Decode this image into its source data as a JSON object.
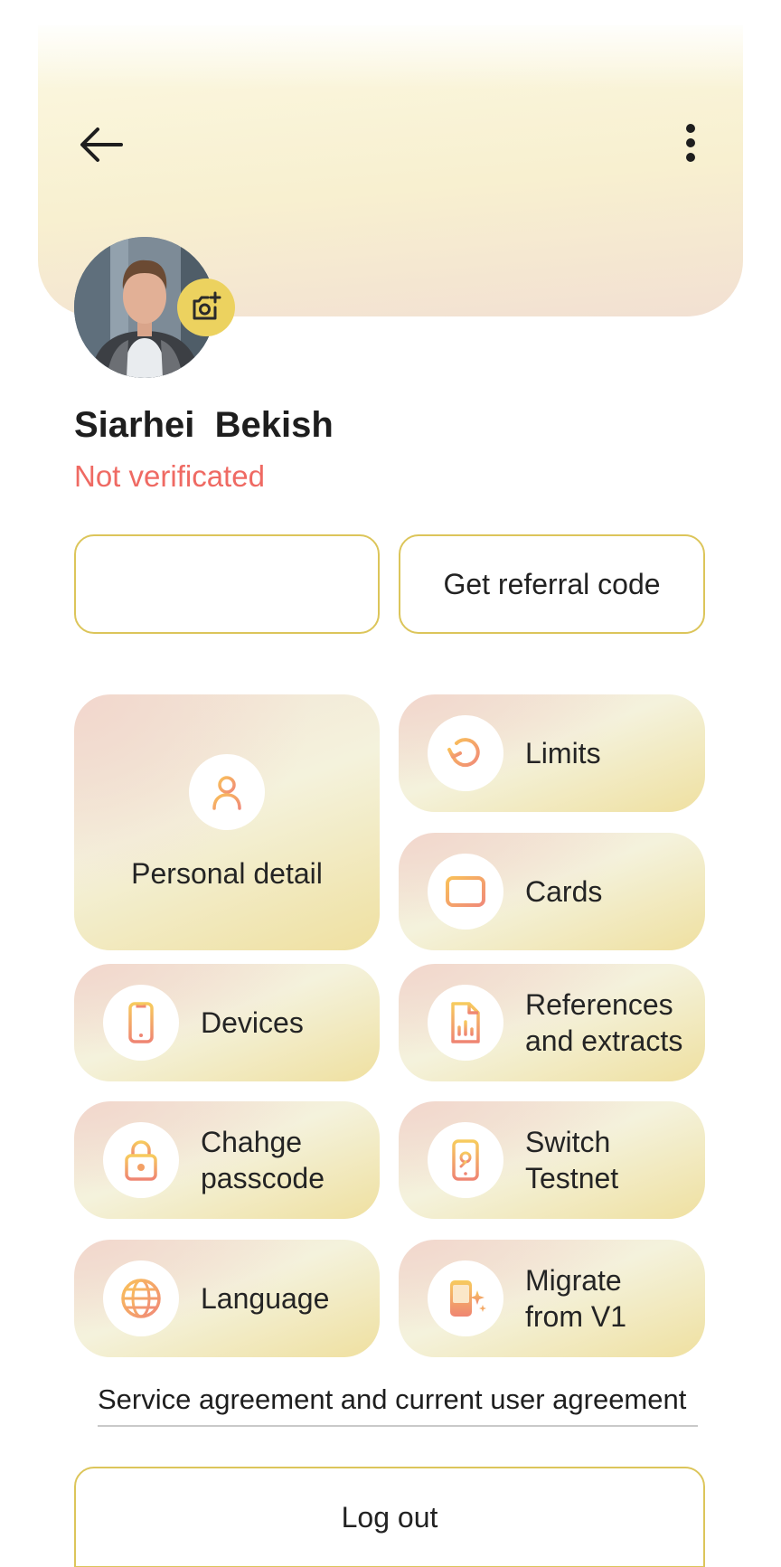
{
  "header": {
    "back_icon": "arrow-left-icon",
    "more_icon": "more-vertical-icon"
  },
  "profile": {
    "name": "Siarhei  Bekish",
    "status": "Not verificated",
    "status_color": "#ef6a63",
    "camera_icon": "camera-plus-icon"
  },
  "actions": {
    "left_button_label": "",
    "referral_button_label": "Get referral code"
  },
  "menu": {
    "personal_detail": {
      "label": "Personal detail",
      "icon": "user-icon"
    },
    "limits": {
      "label": "Limits",
      "icon": "refresh-icon"
    },
    "cards": {
      "label": "Cards",
      "icon": "credit-card-icon"
    },
    "devices": {
      "label": "Devices",
      "icon": "smartphone-icon"
    },
    "references": {
      "label_line1": "References",
      "label_line2": "and extracts",
      "icon": "document-chart-icon"
    },
    "passcode": {
      "label_line1": "Chahge",
      "label_line2": "passcode",
      "icon": "lock-icon"
    },
    "testnet": {
      "label_line1": "Switch",
      "label_line2": "Testnet",
      "icon": "phone-switch-icon"
    },
    "language": {
      "label": "Language",
      "icon": "globe-icon"
    },
    "migrate": {
      "label_line1": "Migrate",
      "label_line2": "from V1",
      "icon": "sparkle-phone-icon"
    }
  },
  "footer": {
    "agreement_link": "Service agreement and current user agreement",
    "logout_label": "Log out"
  },
  "colors": {
    "accent_yellow": "#ecd25f",
    "icon_gradient_start": "#f9c05a",
    "icon_gradient_end": "#f08a78"
  }
}
